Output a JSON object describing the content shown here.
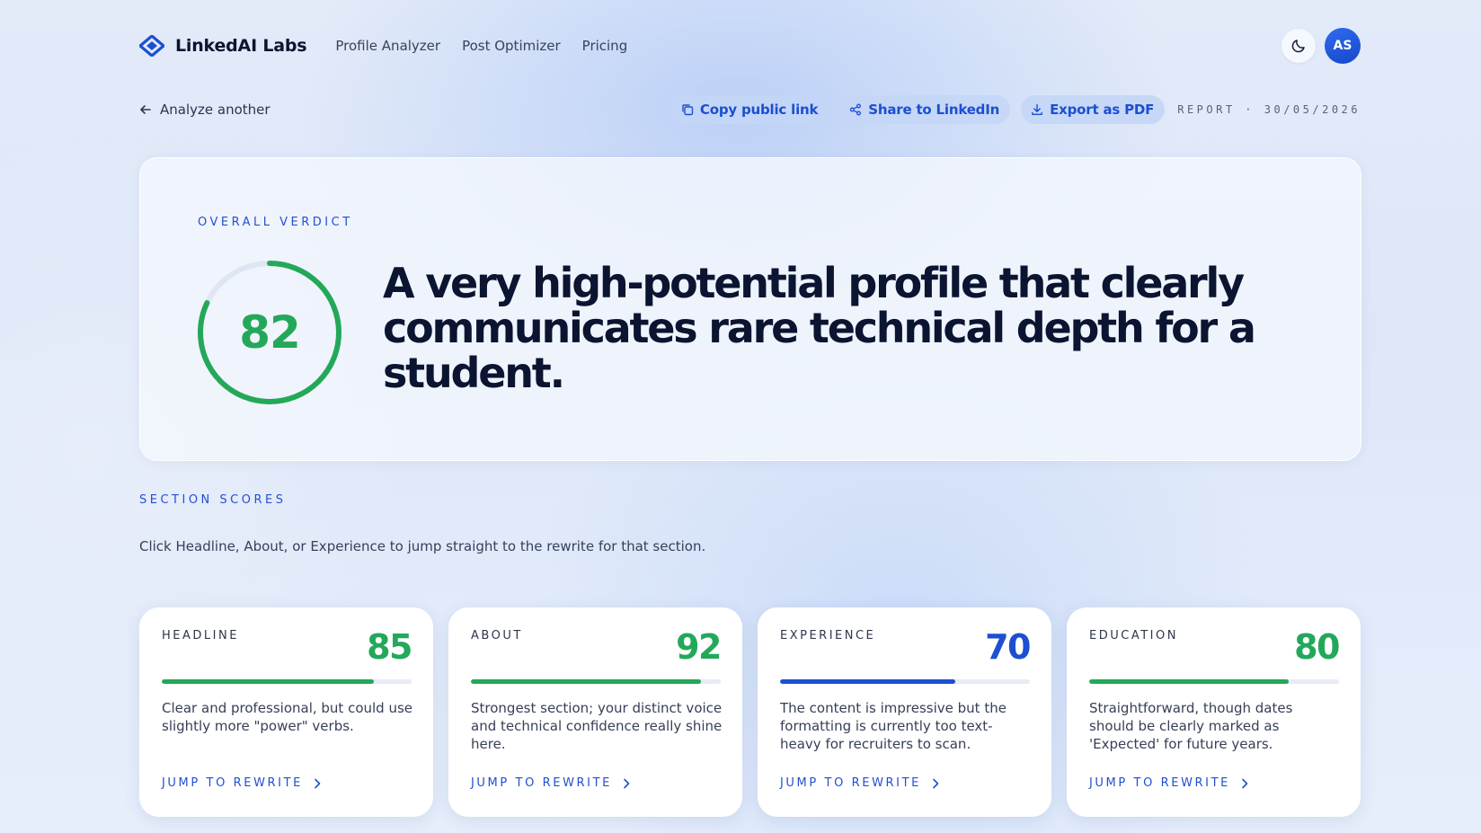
{
  "brand": {
    "name": "LinkedAI Labs",
    "logo_icon": "diamond-logo-icon"
  },
  "nav": {
    "links": [
      "Profile Analyzer",
      "Post Optimizer",
      "Pricing"
    ],
    "avatar_initials": "AS",
    "theme_icon": "moon-icon"
  },
  "toolbar": {
    "back_label": "Analyze another",
    "copy_label": "Copy public link",
    "share_label": "Share to LinkedIn",
    "export_label": "Export as PDF",
    "report_label": "REPORT · 30/05/2026"
  },
  "verdict": {
    "eyebrow": "OVERALL VERDICT",
    "score": "82",
    "score_value": 82,
    "headline": "A very high-potential profile that clearly communicates rare technical depth for a student."
  },
  "sections": {
    "eyebrow": "SECTION SCORES",
    "description": "Click Headline, About, or Experience to jump straight to the rewrite for that section.",
    "jump_label": "JUMP TO REWRITE",
    "cards": [
      {
        "label": "HEADLINE",
        "score": "85",
        "value": 85,
        "color": "#23a85a",
        "desc": "Clear and professional, but could use slightly more \"power\" verbs."
      },
      {
        "label": "ABOUT",
        "score": "92",
        "value": 92,
        "color": "#23a85a",
        "desc": "Strongest section; your distinct voice and technical confidence really shine here."
      },
      {
        "label": "EXPERIENCE",
        "score": "70",
        "value": 70,
        "color": "#1c4fd1",
        "desc": "The content is impressive but the formatting is currently too text-heavy for recruiters to scan."
      },
      {
        "label": "EDUCATION",
        "score": "80",
        "value": 80,
        "color": "#23a85a",
        "desc": "Straightforward, though dates should be clearly marked as 'Expected' for future years."
      }
    ]
  },
  "colors": {
    "accent": "#1c4fd1",
    "success": "#23a85a",
    "ink": "#0b1430"
  }
}
